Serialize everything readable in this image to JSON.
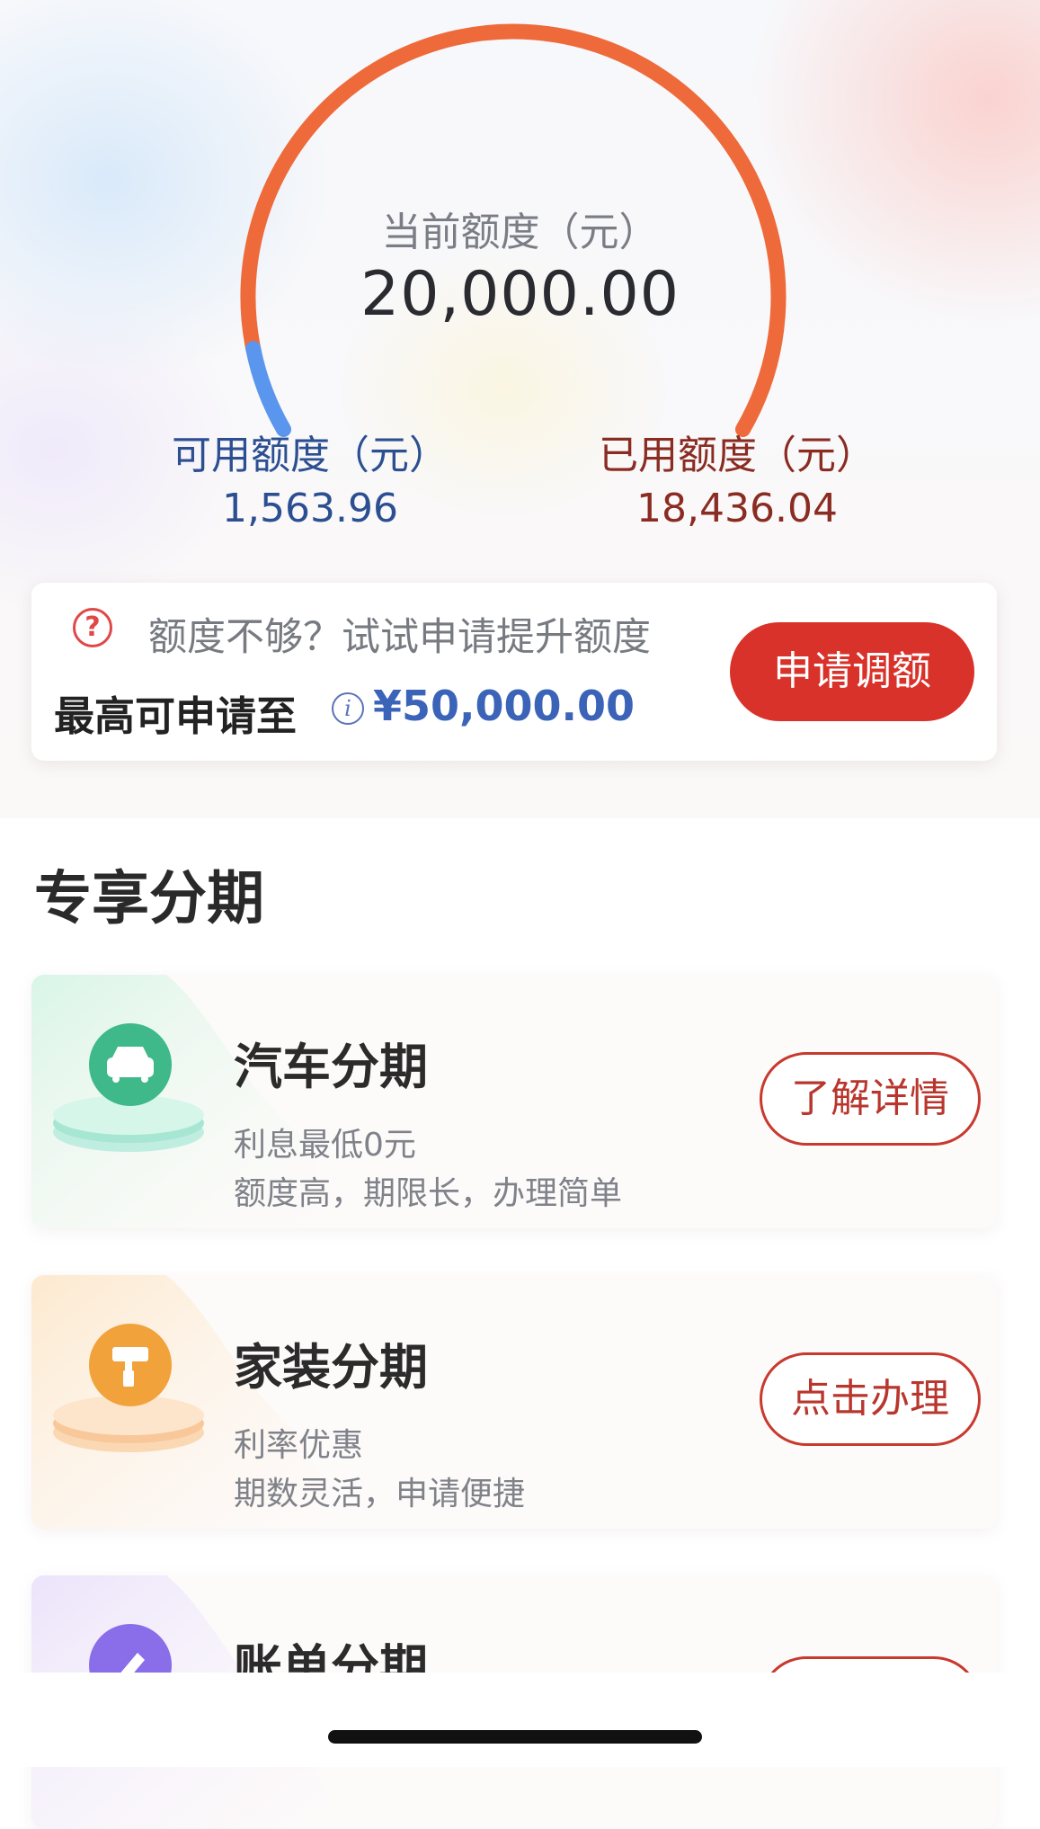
{
  "limit": {
    "current_label": "当前额度（元）",
    "current_value": "20,000.00",
    "available_label": "可用额度（元）",
    "available_value": "1,563.96",
    "used_label": "已用额度（元）",
    "used_value": "18,436.04",
    "available_fraction": 0.078
  },
  "promo": {
    "hint": "额度不够？试试申请提升额度",
    "max_label": "最高可申请至",
    "max_amount": "¥50,000.00",
    "button_label": "申请调额"
  },
  "section": {
    "title": "专享分期"
  },
  "cards": [
    {
      "title": "汽车分期",
      "sub1": "利息最低0元",
      "sub2": "额度高，期限长，办理简单",
      "button": "了解详情",
      "icon": "car-icon",
      "accent": "#3fb88a"
    },
    {
      "title": "家装分期",
      "sub1": "利率优惠",
      "sub2": "期数灵活，申请便捷",
      "button": "点击办理",
      "icon": "paint-roller-icon",
      "accent": "#f2a23a"
    },
    {
      "title": "账单分期",
      "sub1": "",
      "sub2": "",
      "button": "",
      "icon": "pencil-icon",
      "accent": "#8a6de8"
    }
  ],
  "colors": {
    "gauge_used": "#ee6a3a",
    "gauge_available": "#5a95ee",
    "primary_button": "#d8322a"
  }
}
